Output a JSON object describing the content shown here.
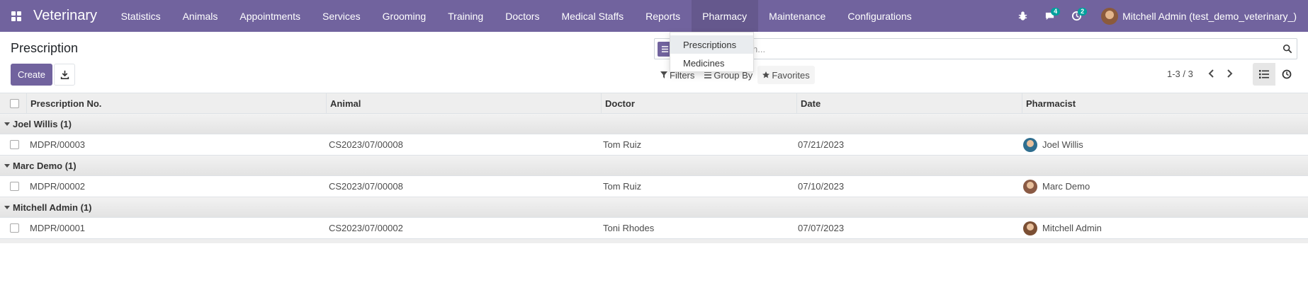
{
  "navbar": {
    "brand": "Veterinary",
    "menu": [
      "Statistics",
      "Animals",
      "Appointments",
      "Services",
      "Grooming",
      "Training",
      "Doctors",
      "Medical Staffs",
      "Reports",
      "Pharmacy",
      "Maintenance",
      "Configurations"
    ],
    "active_menu": "Pharmacy",
    "messages_count": "4",
    "activities_count": "2",
    "user": "Mitchell Admin (test_demo_veterinary_)"
  },
  "pharmacy_dropdown": [
    "Prescriptions",
    "Medicines"
  ],
  "page": {
    "title": "Prescription",
    "create_label": "Create"
  },
  "search": {
    "placeholder": "Search...",
    "visible_text": "arch..."
  },
  "filters": {
    "filters_label": "Filters",
    "groupby_label": "Group By",
    "favorites_label": "Favorites"
  },
  "pager": "1-3 / 3",
  "table": {
    "columns": [
      "Prescription No.",
      "Animal",
      "Doctor",
      "Date",
      "Pharmacist"
    ],
    "groups": [
      {
        "label": "Joel Willis (1)",
        "rows": [
          {
            "no": "MDPR/00003",
            "animal": "CS2023/07/00008",
            "doctor": "Tom Ruiz",
            "date": "07/21/2023",
            "pharmacist": "Joel Willis"
          }
        ]
      },
      {
        "label": "Marc Demo (1)",
        "rows": [
          {
            "no": "MDPR/00002",
            "animal": "CS2023/07/00008",
            "doctor": "Tom Ruiz",
            "date": "07/10/2023",
            "pharmacist": "Marc Demo"
          }
        ]
      },
      {
        "label": "Mitchell Admin (1)",
        "rows": [
          {
            "no": "MDPR/00001",
            "animal": "CS2023/07/00002",
            "doctor": "Toni Rhodes",
            "date": "07/07/2023",
            "pharmacist": "Mitchell Admin"
          }
        ]
      }
    ]
  },
  "colors": {
    "brand": "#71639e",
    "badge": "#00a09d"
  }
}
